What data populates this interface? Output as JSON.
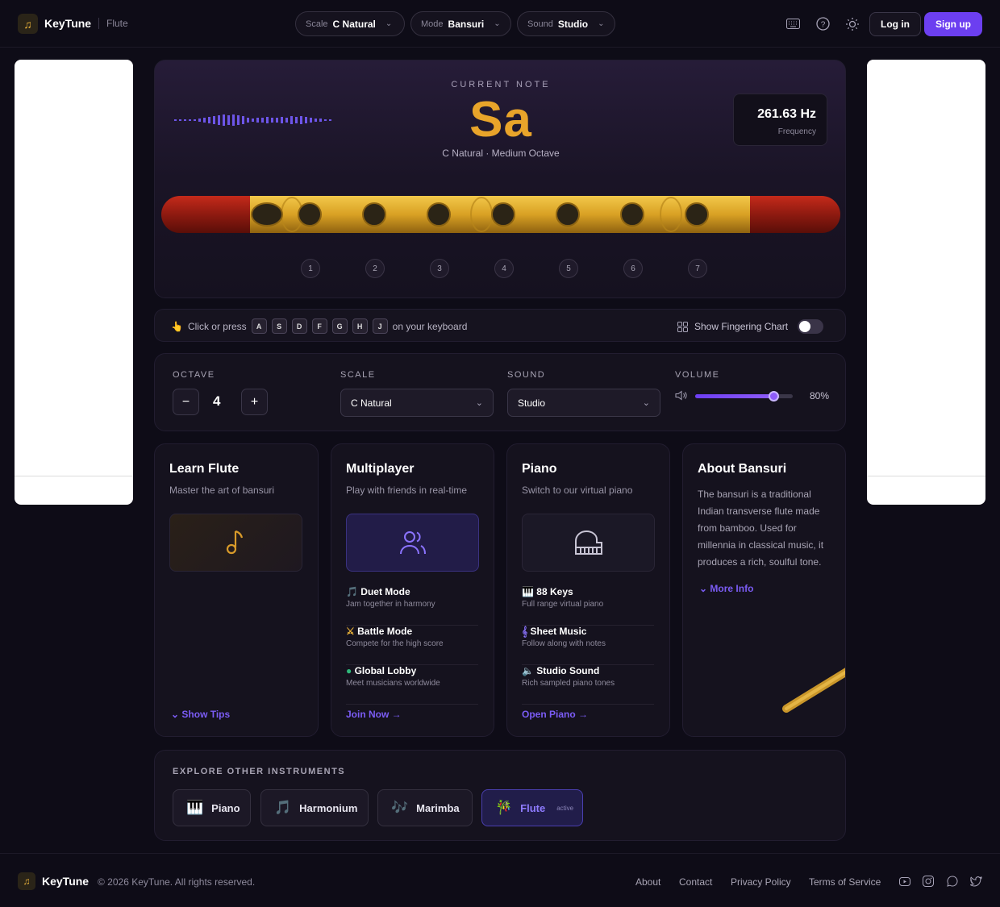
{
  "header": {
    "brand": "KeyTune",
    "instrument": "Flute",
    "pills": [
      {
        "key": "Scale",
        "value": "C Natural"
      },
      {
        "key": "Mode",
        "value": "Bansuri"
      },
      {
        "key": "Sound",
        "value": "Studio"
      }
    ],
    "login": "Log in",
    "signup": "Sign up"
  },
  "note": {
    "label": "CURRENT NOTE",
    "name": "Sa",
    "subtitle": "C Natural · Medium Octave",
    "frequency": "261.63 Hz",
    "frequency_label": "Frequency",
    "holes": [
      "1",
      "2",
      "3",
      "4",
      "5",
      "6",
      "7"
    ]
  },
  "keyboard": {
    "prefix": "Click or press",
    "keys": [
      "A",
      "S",
      "D",
      "F",
      "G",
      "H",
      "J"
    ],
    "suffix": "on your keyboard",
    "chart_toggle": "Show Fingering Chart",
    "chart_toggle_on": false
  },
  "controls": {
    "octave_label": "OCTAVE",
    "octave_value": "4",
    "scale_label": "SCALE",
    "scale_value": "C Natural",
    "sound_label": "SOUND",
    "sound_value": "Studio",
    "volume_label": "VOLUME",
    "volume_value": "80%",
    "volume_fraction": 0.8
  },
  "cards": {
    "learn": {
      "title": "Learn Flute",
      "subtitle": "Master the art of bansuri",
      "link": "Show Tips"
    },
    "multi": {
      "title": "Multiplayer",
      "subtitle": "Play with friends in real-time",
      "features": [
        {
          "icon": "🎵",
          "title": "Duet Mode",
          "desc": "Jam together in harmony"
        },
        {
          "icon": "⚔",
          "title": "Battle Mode",
          "desc": "Compete for the high score"
        },
        {
          "icon": "●",
          "title": "Global Lobby",
          "desc": "Meet musicians worldwide"
        }
      ],
      "link": "Join Now →"
    },
    "piano": {
      "title": "Piano",
      "subtitle": "Switch to our virtual piano",
      "features": [
        {
          "icon": "🎹",
          "title": "88 Keys",
          "desc": "Full range virtual piano"
        },
        {
          "icon": "𝄞",
          "title": "Sheet Music",
          "desc": "Follow along with notes"
        },
        {
          "icon": "🔈",
          "title": "Studio Sound",
          "desc": "Rich sampled piano tones"
        }
      ],
      "link": "Open Piano →"
    },
    "about": {
      "title": "About Bansuri",
      "text": "The bansuri is a traditional Indian transverse flute made from bamboo. Used for millennia in classical music, it produces a rich, soulful tone.",
      "link": "More Info"
    }
  },
  "explore": {
    "label": "EXPLORE OTHER INSTRUMENTS",
    "items": [
      {
        "name": "Piano",
        "icon": "🎹"
      },
      {
        "name": "Harmonium",
        "icon": "🎵"
      },
      {
        "name": "Marimba",
        "icon": "🎶"
      },
      {
        "name": "Flute",
        "icon": "🎋",
        "badge": "active"
      }
    ]
  },
  "footer": {
    "brand": "KeyTune",
    "copyright": "© 2026 KeyTune. All rights reserved.",
    "links": [
      "About",
      "Contact",
      "Privacy Policy",
      "Terms of Service"
    ]
  },
  "colors": {
    "accent": "#6c3ff0",
    "note": "#e8a42a",
    "link": "#7b5cf5"
  }
}
